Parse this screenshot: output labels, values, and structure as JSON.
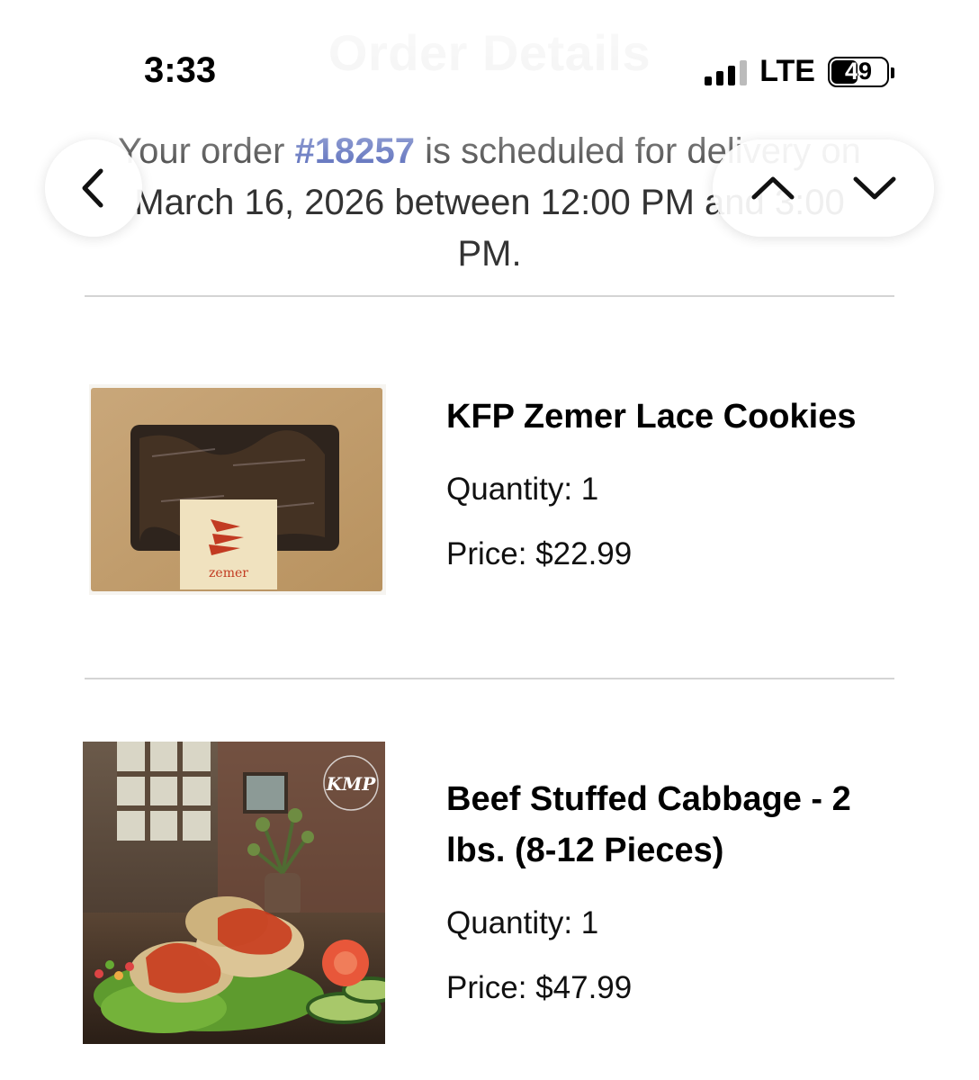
{
  "status_bar": {
    "time": "3:33",
    "network": "LTE",
    "battery": "49",
    "battery_level": 0.49
  },
  "header": {
    "title": "Order Details"
  },
  "order": {
    "msg_prefix": "Your order ",
    "number": "#18257",
    "msg_suffix": " is scheduled for delivery on March 16, 2026 between 12:00 PM and 3:00 PM."
  },
  "nav": {
    "back_icon": "chevron-left-icon",
    "up_icon": "chevron-up-icon",
    "down_icon": "chevron-down-icon"
  },
  "items": [
    {
      "name": "KFP Zemer Lace Cookies",
      "quantity": "Quantity: 1",
      "price": "Price: $22.99",
      "image_brand": "zemer"
    },
    {
      "name": "Beef Stuffed Cabbage - 2 lbs. (8-12 Pieces)",
      "quantity": "Quantity: 1",
      "price": "Price: $47.99",
      "image_brand": "KMP"
    }
  ]
}
